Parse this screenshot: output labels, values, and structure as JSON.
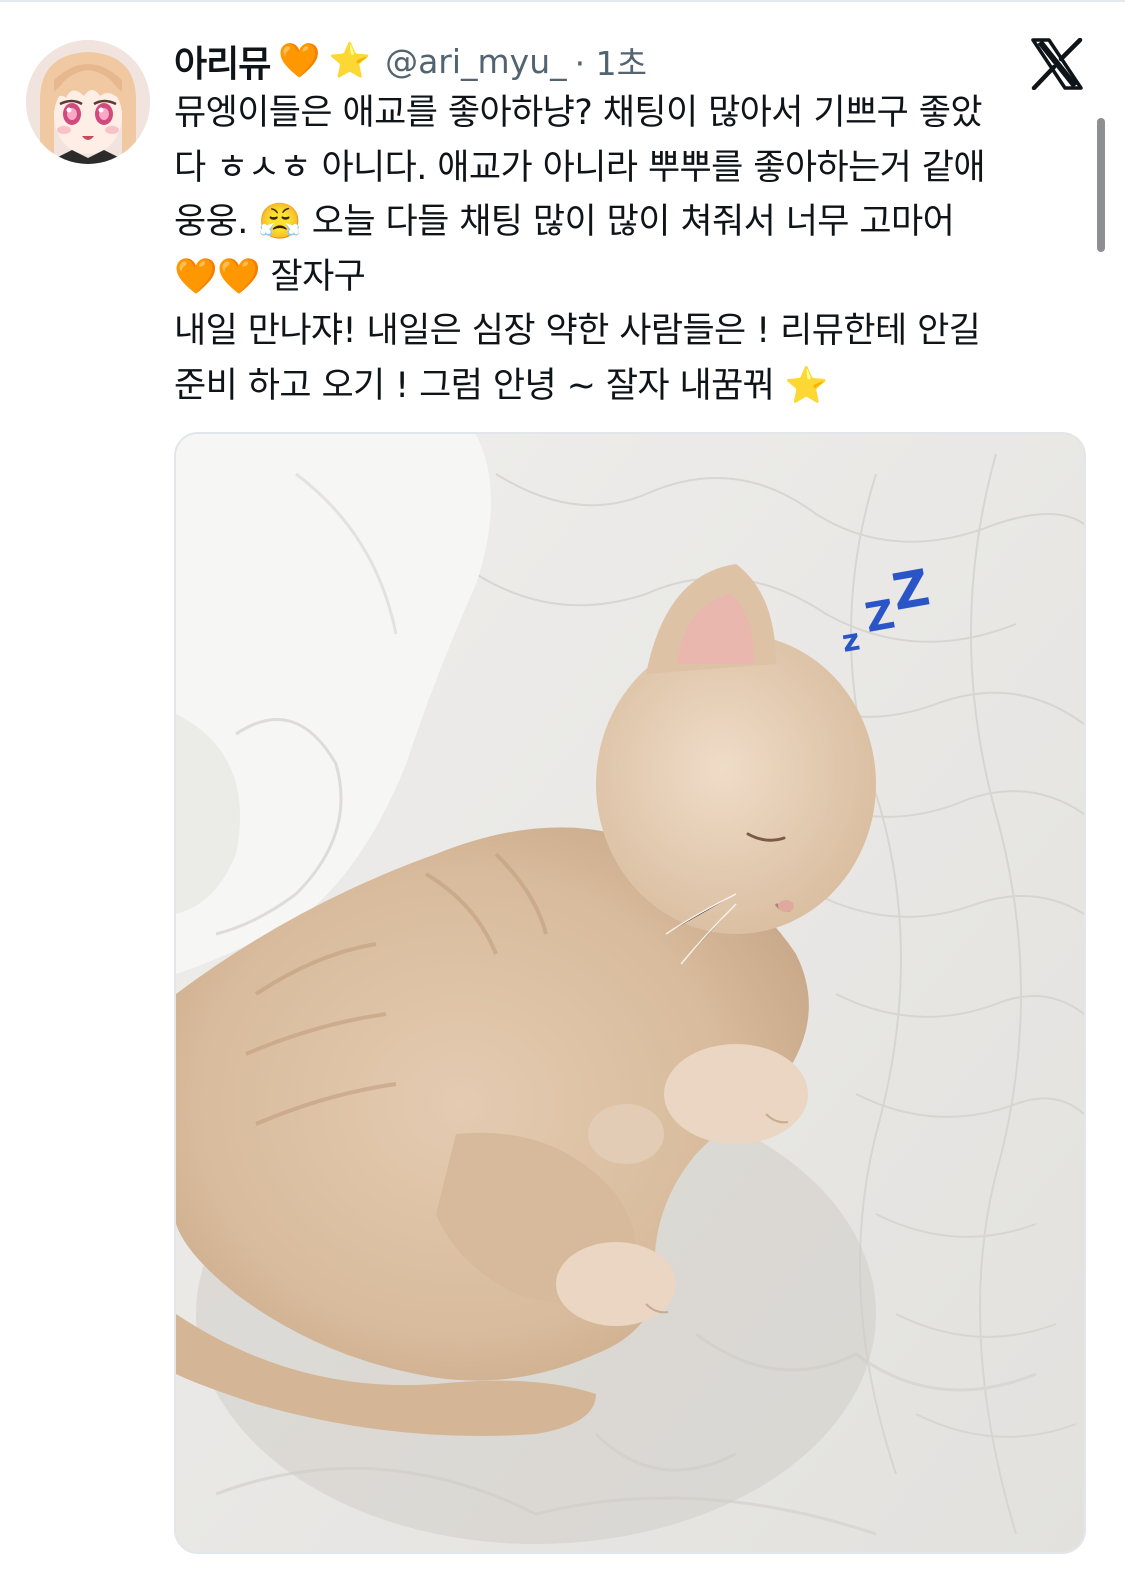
{
  "tweet": {
    "display_name": "아리뮤",
    "name_emojis": [
      "🧡",
      "⭐"
    ],
    "handle": "@ari_myu_",
    "time": "· 1초",
    "text_lines": [
      "뮤엥이들은 애교를 좋아하냥? 채팅이 많아서 기쁘구 좋았",
      "다 ㅎㅅㅎ 아니다. 애교가 아니라 뿌뿌를 좋아하는거 같애",
      "웅웅. 😤 오늘 다들 채팅 많이 많이 쳐줘서 너무 고마어",
      "🧡🧡 잘자구",
      "내일 만나쟈! 내일은 심장 약한 사람들은 ! 리뮤한테 안길",
      "준비 하고 오기 ! 그럼 안녕 ~ 잘자 내꿈꿔 ⭐"
    ]
  },
  "media": {
    "overlay_text": "zZZ",
    "overlay_color": "#2b54c7"
  },
  "icons": {
    "platform_logo": "x-logo-icon",
    "avatar": "anime-avatar"
  },
  "colors": {
    "text": "#0f1419",
    "secondary": "#536471",
    "orange_heart": "#f4891f",
    "star": "#ffcc33"
  }
}
